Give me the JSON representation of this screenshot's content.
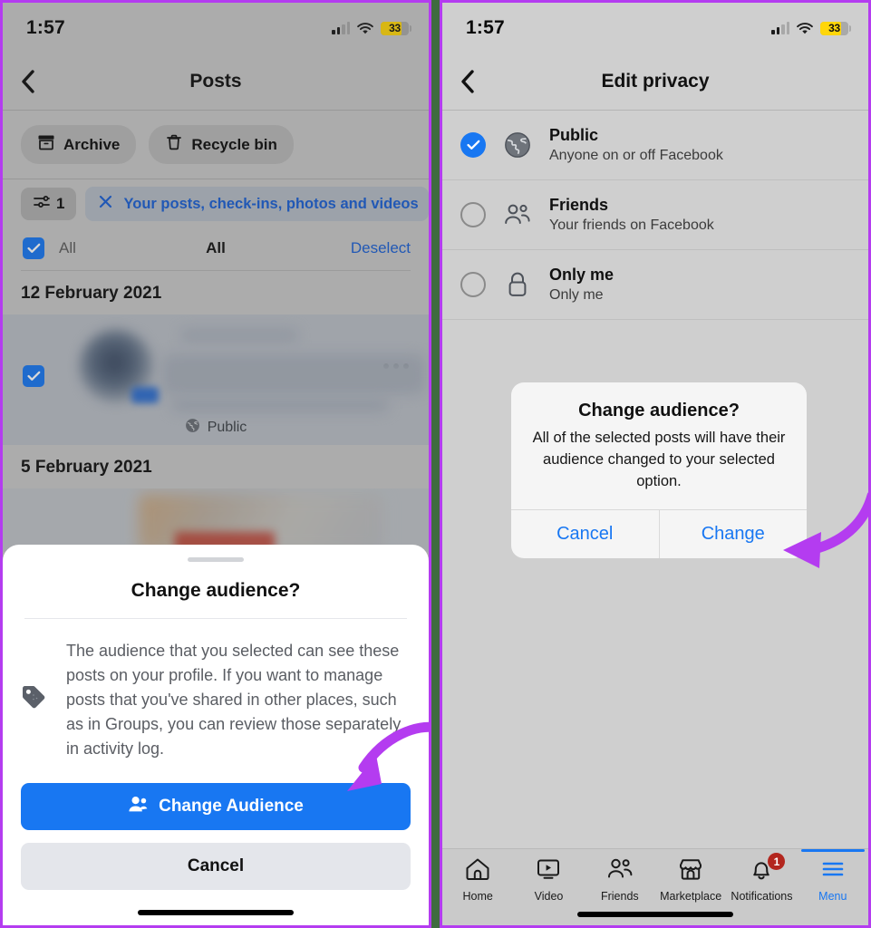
{
  "left_phone": {
    "status_bar": {
      "time": "1:57",
      "battery_percent": "33",
      "signal_icon": "cellular-signal-icon",
      "wifi_icon": "wifi-icon",
      "battery_icon": "battery-icon"
    },
    "nav": {
      "back_icon": "back-chevron-icon",
      "title": "Posts"
    },
    "chips": [
      {
        "label": "Archive",
        "icon": "archive-box-icon"
      },
      {
        "label": "Recycle bin",
        "icon": "trash-icon"
      }
    ],
    "filter": {
      "count": "1",
      "count_icon": "filter-sliders-icon",
      "pill_label": "Your posts, check-ins, photos and videos",
      "pill_close_icon": "close-x-icon"
    },
    "select_row": {
      "checkbox_icon": "checkbox-checked-icon",
      "left_label": "All",
      "center_label": "All",
      "right_label": "Deselect"
    },
    "sections": [
      {
        "date": "12 February 2021",
        "post": {
          "checkbox_icon": "checkbox-checked-icon",
          "more_icon": "more-dots-icon",
          "privacy_icon": "globe-icon",
          "privacy_label": "Public"
        }
      },
      {
        "date": "5 February 2021",
        "post": {
          "checkbox_icon": "checkbox-unchecked-icon"
        }
      }
    ],
    "sheet": {
      "title": "Change audience?",
      "icon": "tag-icon",
      "body": "The audience that you selected can see these posts on your profile. If you want to manage posts that you've shared in other places, such as in Groups, you can review those separately in activity log.",
      "primary_label": "Change Audience",
      "primary_icon": "person-add-icon",
      "secondary_label": "Cancel"
    }
  },
  "right_phone": {
    "status_bar": {
      "time": "1:57",
      "battery_percent": "33",
      "signal_icon": "cellular-signal-icon",
      "wifi_icon": "wifi-icon",
      "battery_icon": "battery-icon"
    },
    "nav": {
      "back_icon": "back-chevron-icon",
      "title": "Edit privacy"
    },
    "options": [
      {
        "title": "Public",
        "subtitle": "Anyone on or off Facebook",
        "icon": "globe-icon",
        "selected": true,
        "radio_icon": "radio-selected-icon"
      },
      {
        "title": "Friends",
        "subtitle": "Your friends on Facebook",
        "icon": "friends-icon",
        "selected": false,
        "radio_icon": "radio-unselected-icon"
      },
      {
        "title": "Only me",
        "subtitle": "Only me",
        "icon": "lock-icon",
        "selected": false,
        "radio_icon": "radio-unselected-icon"
      }
    ],
    "alert": {
      "title": "Change audience?",
      "message": "All of the selected posts will have their audience changed to your selected option.",
      "cancel_label": "Cancel",
      "confirm_label": "Change"
    },
    "tabbar": [
      {
        "label": "Home",
        "icon": "home-icon",
        "active": false,
        "badge": ""
      },
      {
        "label": "Video",
        "icon": "video-icon",
        "active": false,
        "badge": ""
      },
      {
        "label": "Friends",
        "icon": "friends-icon",
        "active": false,
        "badge": ""
      },
      {
        "label": "Marketplace",
        "icon": "marketplace-icon",
        "active": false,
        "badge": ""
      },
      {
        "label": "Notifications",
        "icon": "bell-icon",
        "active": false,
        "badge": "1"
      },
      {
        "label": "Menu",
        "icon": "hamburger-menu-icon",
        "active": true,
        "badge": ""
      }
    ]
  },
  "annotations": {
    "arrow_left": {
      "name": "arrow-pointing-to-change-audience-button",
      "color": "#b43cf0"
    },
    "arrow_right": {
      "name": "arrow-pointing-to-change-button",
      "color": "#b43cf0"
    }
  },
  "colors": {
    "accent_blue": "#1877f2",
    "link_blue": "#1b60d4",
    "annotation_purple": "#b43cf0",
    "badge_red": "#b3261e",
    "battery_yellow": "#ffd60a"
  }
}
